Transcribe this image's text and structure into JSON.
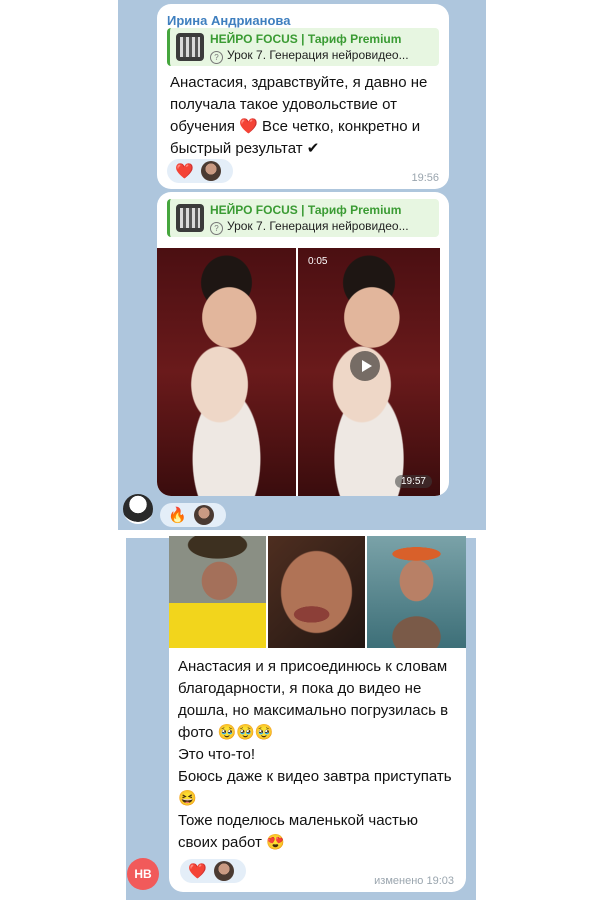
{
  "messages": [
    {
      "sender": "Ирина Андрианова",
      "reply": {
        "title": "НЕЙРО FOCUS | Тариф Premium",
        "subtitle": "Урок 7. Генерация нейровидео..."
      },
      "text": "Анастасия, здравствуйте, я давно не получала такое удовольствие от обучения ❤️ Все четко, конкретно и быстрый результат ✔",
      "reactions": {
        "emoji": "❤️"
      },
      "time": "19:56"
    },
    {
      "reply": {
        "title": "НЕЙРО FOCUS | Тариф Premium",
        "subtitle": "Урок 7. Генерация нейровидео..."
      },
      "video_duration": "0:05",
      "time": "19:57",
      "reactions": {
        "emoji": "🔥"
      }
    },
    {
      "text": "Анастасия и я присоединюсь к словам благодарности, я пока до видео не дошла, но максимально погрузилась в фото 🥹🥹🥹\nЭто что-то!\nБоюсь даже к видео завтра приступать 😆\nТоже поделюсь маленькой частью своих работ 😍",
      "reactions": {
        "emoji": "❤️"
      },
      "time": "изменено 19:03"
    }
  ],
  "avatars": {
    "bottom_initials": "НВ"
  },
  "icons": {
    "reply_lesson": "lesson-icon",
    "play": "play-icon",
    "check": "check-icon"
  },
  "colors": {
    "chat_bg": "#aec6dd",
    "accent": "#3f7fbf",
    "reply_green": "#46a63e",
    "avatar_nb": "#f15a5a"
  }
}
